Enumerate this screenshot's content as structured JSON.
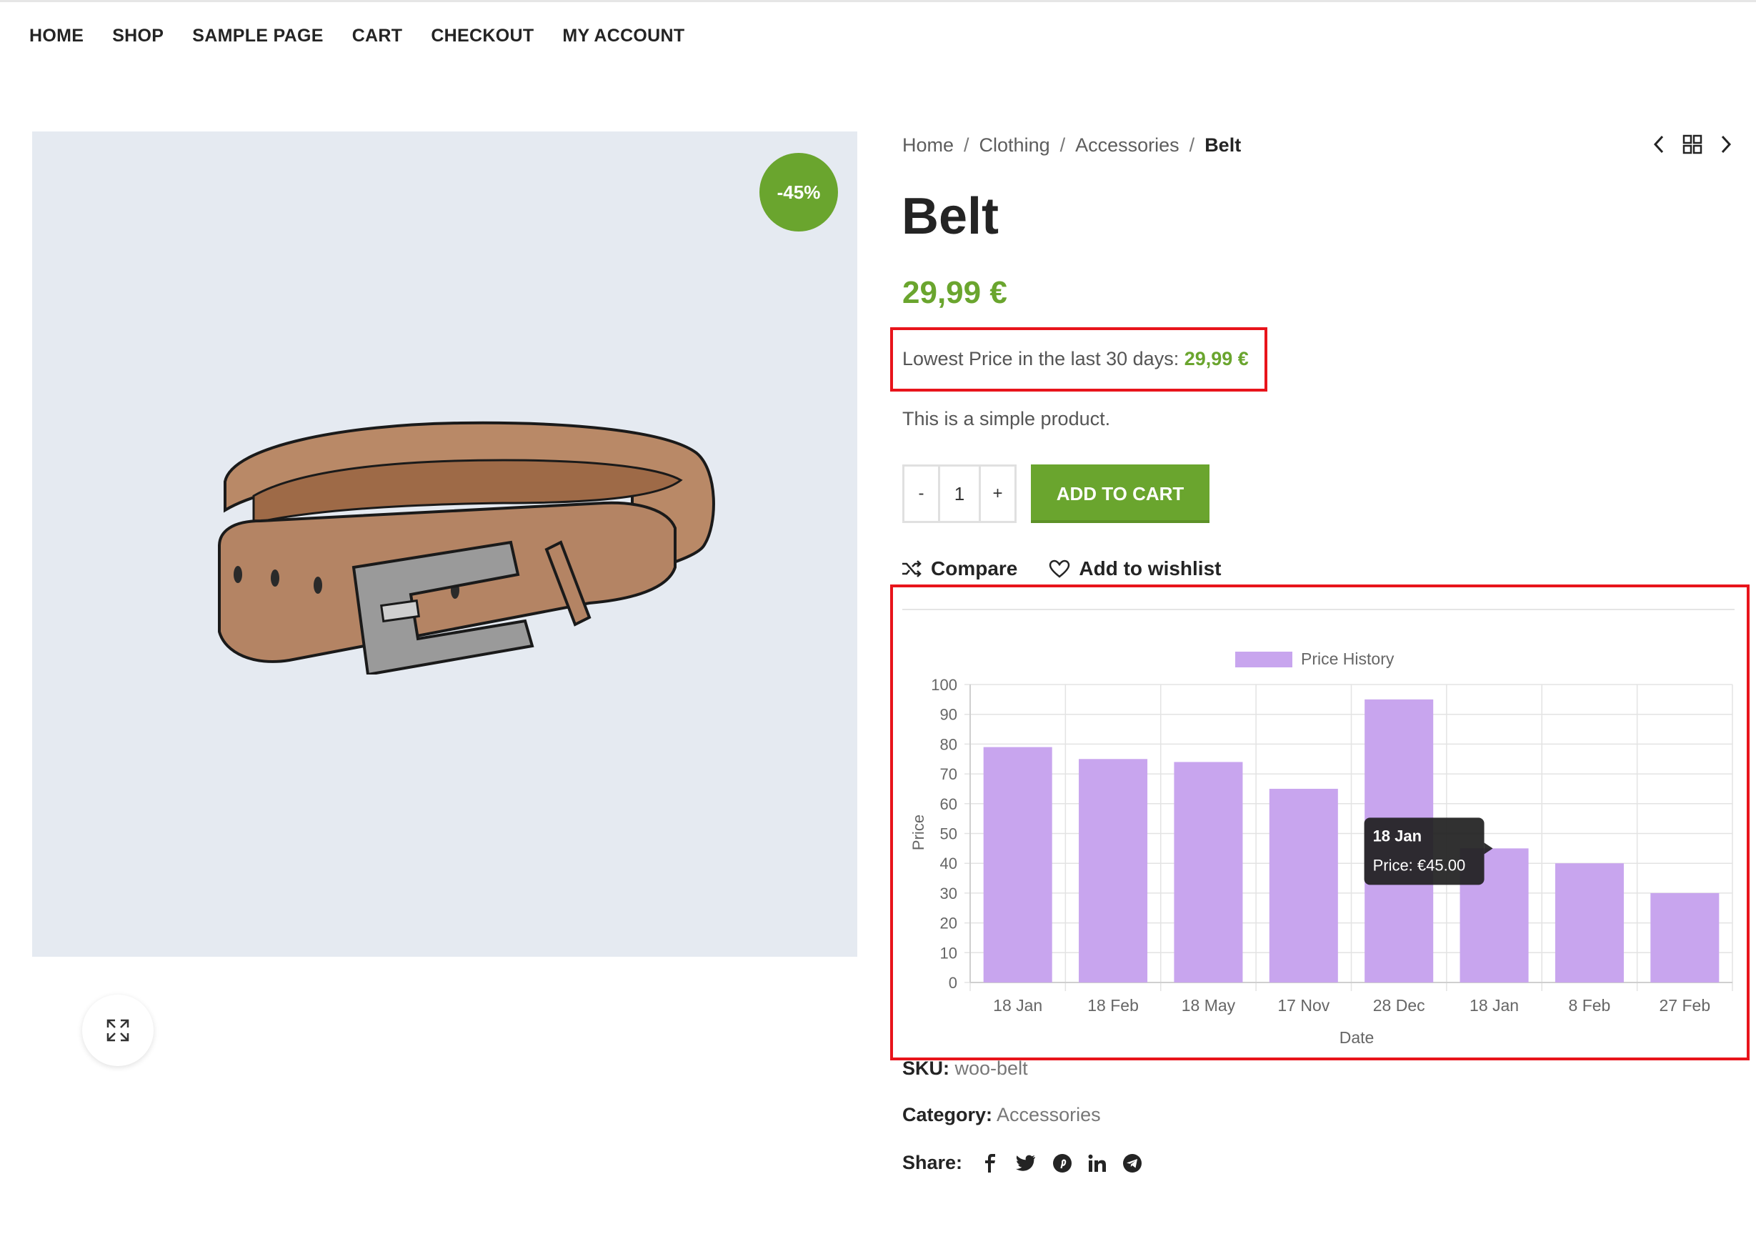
{
  "nav": [
    "HOME",
    "SHOP",
    "SAMPLE PAGE",
    "CART",
    "CHECKOUT",
    "MY ACCOUNT"
  ],
  "product": {
    "sale_badge": "-45%",
    "breadcrumb": [
      "Home",
      "Clothing",
      "Accessories"
    ],
    "breadcrumb_current": "Belt",
    "title": "Belt",
    "price": "29,99 €",
    "lowest_label": "Lowest Price in the last 30 days:",
    "lowest_value": "29,99 €",
    "description": "This is a simple product.",
    "qty_minus": "-",
    "qty_value": "1",
    "qty_plus": "+",
    "add_to_cart": "ADD TO CART",
    "compare": "Compare",
    "wishlist": "Add to wishlist",
    "sku_label": "SKU:",
    "sku_value": "woo-belt",
    "category_label": "Category:",
    "category_value": "Accessories",
    "share_label": "Share:",
    "share_icons": [
      "facebook-icon",
      "twitter-icon",
      "pinterest-icon",
      "linkedin-icon",
      "telegram-icon"
    ]
  },
  "colors": {
    "accent": "#6aa52e",
    "bar": "#c8a5ee",
    "highlight": "#e8141b"
  },
  "chart_data": {
    "type": "bar",
    "legend": "Price History",
    "categories": [
      "18 Jan",
      "18 Feb",
      "18 May",
      "17 Nov",
      "28 Dec",
      "18 Jan",
      "8 Feb",
      "27 Feb"
    ],
    "series": [
      {
        "name": "Price History",
        "values": [
          79,
          75,
          74,
          65,
          95,
          45,
          40,
          30
        ]
      }
    ],
    "xlabel": "Date",
    "ylabel": "Price",
    "ylim": [
      0,
      100
    ],
    "yticks": [
      0,
      10,
      20,
      30,
      40,
      50,
      60,
      70,
      80,
      90,
      100
    ],
    "grid": true,
    "tooltip": {
      "title": "18 Jan",
      "body": "Price: €45.00",
      "index": 5
    }
  }
}
